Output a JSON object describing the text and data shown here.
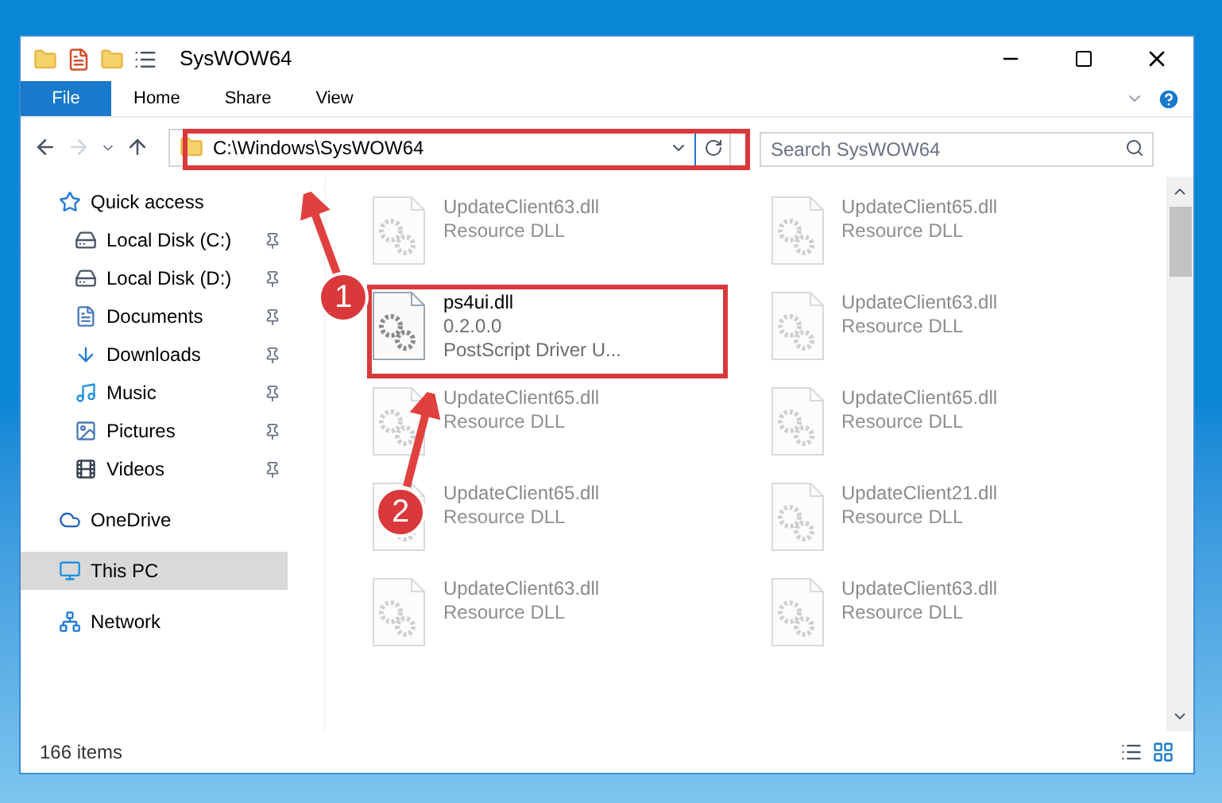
{
  "window": {
    "title": "SysWOW64"
  },
  "ribbon_tabs": [
    {
      "label": "File",
      "selected": true
    },
    {
      "label": "Home",
      "selected": false
    },
    {
      "label": "Share",
      "selected": false
    },
    {
      "label": "View",
      "selected": false
    }
  ],
  "address": {
    "path": "C:\\Windows\\SysWOW64"
  },
  "search": {
    "placeholder": "Search SysWOW64"
  },
  "sidebar": {
    "items": [
      {
        "label": "Quick access",
        "kind": "star",
        "selected": false,
        "children": [
          {
            "label": "Local Disk (C:)",
            "kind": "drive",
            "pinned": true,
            "selected": false
          },
          {
            "label": "Local Disk (D:)",
            "kind": "drive",
            "pinned": true,
            "selected": false
          },
          {
            "label": "Documents",
            "kind": "document",
            "pinned": true,
            "selected": false
          },
          {
            "label": "Downloads",
            "kind": "download",
            "pinned": true,
            "selected": false
          },
          {
            "label": "Music",
            "kind": "music",
            "pinned": true,
            "selected": false
          },
          {
            "label": "Pictures",
            "kind": "pictures",
            "pinned": true,
            "selected": false
          },
          {
            "label": "Videos",
            "kind": "videos",
            "pinned": true,
            "selected": false
          }
        ]
      },
      {
        "label": "OneDrive",
        "kind": "cloud",
        "selected": false
      },
      {
        "label": "This PC",
        "kind": "pc",
        "selected": true
      },
      {
        "label": "Network",
        "kind": "network",
        "selected": false
      }
    ]
  },
  "files": [
    {
      "name": "UpdateClient63.dll",
      "lines": [
        "Resource DLL"
      ],
      "blurred": true
    },
    {
      "name": "UpdateClient65.dll",
      "lines": [
        "Resource DLL"
      ],
      "blurred": true
    },
    {
      "name": "ps4ui.dll",
      "lines": [
        "0.2.0.0",
        "PostScript Driver U..."
      ],
      "blurred": false
    },
    {
      "name": "UpdateClient63.dll",
      "lines": [
        "Resource DLL"
      ],
      "blurred": true
    },
    {
      "name": "UpdateClient65.dll",
      "lines": [
        "Resource DLL"
      ],
      "blurred": true
    },
    {
      "name": "UpdateClient65.dll",
      "lines": [
        "Resource DLL"
      ],
      "blurred": true
    },
    {
      "name": "UpdateClient65.dll",
      "lines": [
        "Resource DLL"
      ],
      "blurred": true
    },
    {
      "name": "UpdateClient21.dll",
      "lines": [
        "Resource DLL"
      ],
      "blurred": true
    },
    {
      "name": "UpdateClient63.dll",
      "lines": [
        "Resource DLL"
      ],
      "blurred": true
    },
    {
      "name": "UpdateClient63.dll",
      "lines": [
        "Resource DLL"
      ],
      "blurred": true
    }
  ],
  "status_bar": {
    "count": "166 items"
  },
  "annotations": [
    {
      "number": "1"
    },
    {
      "number": "2"
    }
  ]
}
